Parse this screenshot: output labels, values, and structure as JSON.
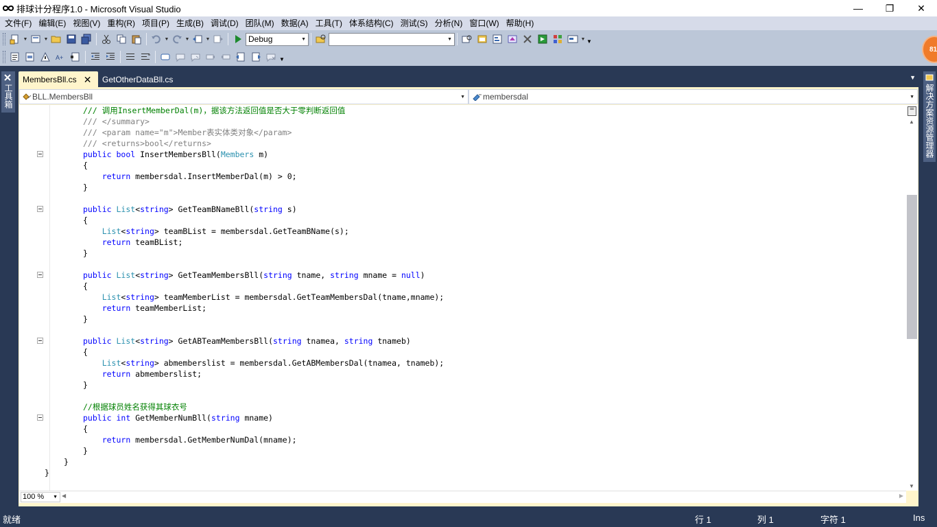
{
  "window": {
    "title": "排球计分程序1.0 - Microsoft Visual Studio",
    "minimize_glyph": "—",
    "restore_glyph": "❐",
    "close_glyph": "✕"
  },
  "menu": [
    "文件(F)",
    "编辑(E)",
    "视图(V)",
    "重构(R)",
    "项目(P)",
    "生成(B)",
    "调试(D)",
    "团队(M)",
    "数据(A)",
    "工具(T)",
    "体系结构(C)",
    "测试(S)",
    "分析(N)",
    "窗口(W)",
    "帮助(H)"
  ],
  "toolbar": {
    "config_value": "Debug",
    "find_value": "",
    "badge": "81"
  },
  "side_panels": {
    "left": "工具箱",
    "right": "解决方案资源管理器"
  },
  "tabs": {
    "active": "MembersBll.cs",
    "other": "GetOtherDataBll.cs"
  },
  "navbar": {
    "type_combo": "BLL.MembersBll",
    "member_combo": "membersdal"
  },
  "code": {
    "lines": [
      "/// 调用InsertMemberDal(m)，据该方法返回值是否大于零判断返回值",
      "/// </summary>",
      "/// <param name=\"m\">Member表实体类对象</param>",
      "/// <returns>bool</returns>",
      "public bool InsertMembersBll(Members m)",
      "{",
      "    return membersdal.InsertMemberDal(m) > 0;",
      "}",
      "",
      "public List<string> GetTeamBNameBll(string s)",
      "{",
      "    List<string> teamBList = membersdal.GetTeamBName(s);",
      "    return teamBList;",
      "}",
      "",
      "public List<string> GetTeamMembersBll(string tname, string mname = null)",
      "{",
      "    List<string> teamMemberList = membersdal.GetTeamMembersDal(tname,mname);",
      "    return teamMemberList;",
      "}",
      "",
      "public List<string> GetABTeamMembersBll(string tnamea, string tnameb)",
      "{",
      "    List<string> abmemberslist = membersdal.GetABMembersDal(tnamea, tnameb);",
      "    return abmemberslist;",
      "}",
      "",
      "//根据球员姓名获得其球衣号",
      "public int GetMemberNumBll(string mname)",
      "{",
      "    return membersdal.GetMemberNumDal(mname);",
      "}",
      "}",
      "}"
    ]
  },
  "editor": {
    "zoom": "100 %"
  },
  "status": {
    "ready": "就绪",
    "row": "行 1",
    "col": "列 1",
    "char": "字符 1",
    "mode": "Ins"
  }
}
